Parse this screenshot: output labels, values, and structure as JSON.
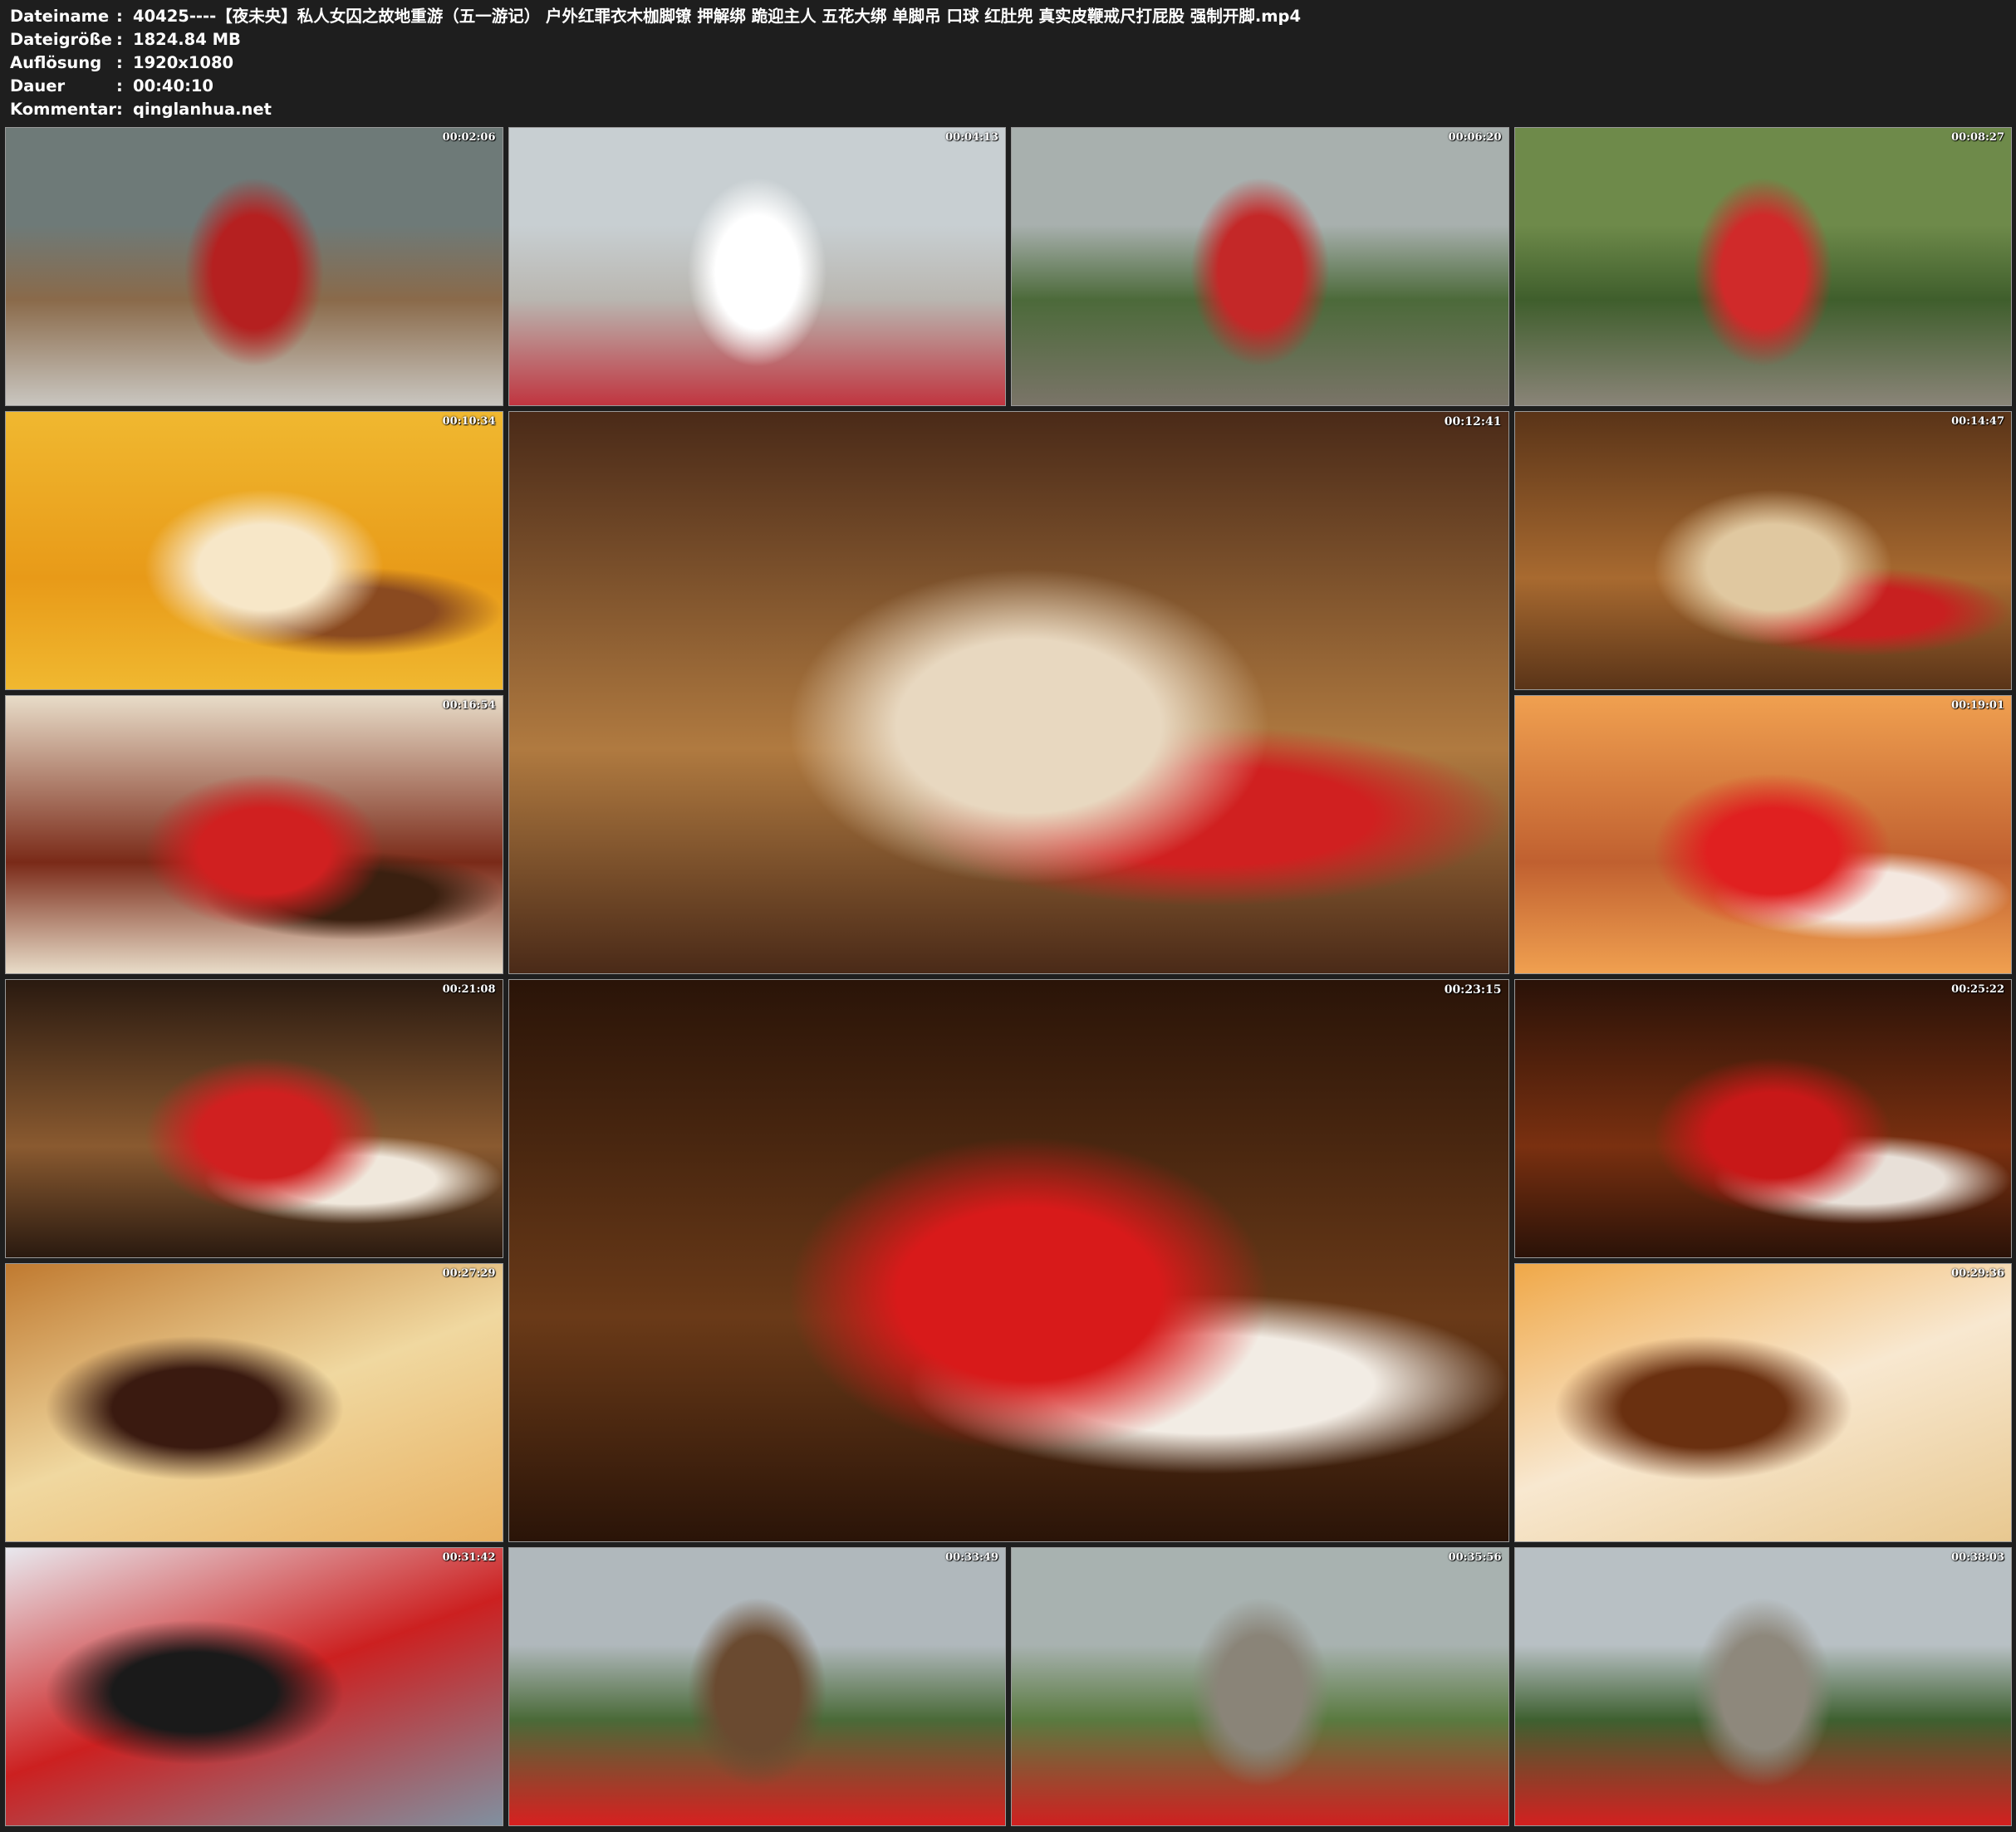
{
  "header": [
    {
      "label": "Dateiname",
      "value": "40425----【夜未央】私人女囚之故地重游（五一游记） 户外红罪衣木枷脚镣 押解绑 跪迎主人 五花大绑 单脚吊 口球 红肚兜 真实皮鞭戒尺打屁股 强制开脚.mp4"
    },
    {
      "label": "Dateigröße",
      "value": "1824.84 MB"
    },
    {
      "label": "Auflösung",
      "value": "1920x1080"
    },
    {
      "label": "Dauer",
      "value": "00:40:10"
    },
    {
      "label": "Kommentar",
      "value": "qinglanhua.net"
    }
  ],
  "separator": ":",
  "thumbnails": [
    {
      "time": "00:02:06",
      "scene": "outdoor-rocks",
      "colors": [
        "#6e7a78",
        "#8a6a4a",
        "#c9c6c0",
        "#b52020"
      ]
    },
    {
      "time": "00:04:13",
      "scene": "pavilion",
      "colors": [
        "#c8cfd2",
        "#b9b6b0",
        "#c03540",
        "#ffffff"
      ]
    },
    {
      "time": "00:06:20",
      "scene": "mountain-path",
      "colors": [
        "#a8b0ae",
        "#4c6a3a",
        "#7a7468",
        "#c42828"
      ]
    },
    {
      "time": "00:08:27",
      "scene": "mountain-path",
      "colors": [
        "#6e8a4a",
        "#3f5e2c",
        "#8a8478",
        "#d02a2a"
      ]
    },
    {
      "time": "00:10:34",
      "scene": "hotel-hallway",
      "colors": [
        "#f0b830",
        "#e89a18",
        "#f7e7c8",
        "#8a4a20"
      ]
    },
    {
      "time": "00:12:41",
      "scene": "sofa-room",
      "big": true,
      "colors": [
        "#4a2a18",
        "#b07a40",
        "#e8d8c0",
        "#d02020"
      ]
    },
    {
      "time": "00:14:47",
      "scene": "sofa-room",
      "colors": [
        "#5a3418",
        "#a86a30",
        "#e0c8a0",
        "#c82020"
      ]
    },
    {
      "time": "00:16:54",
      "scene": "sofa-closeup",
      "colors": [
        "#e8dcc8",
        "#7a2a18",
        "#d02020",
        "#3a2010"
      ]
    },
    {
      "time": "00:19:01",
      "scene": "floor-closeup",
      "colors": [
        "#f0a050",
        "#c06030",
        "#e02020",
        "#f4e8e0"
      ]
    },
    {
      "time": "00:21:08",
      "scene": "room-suspended",
      "colors": [
        "#2a1a10",
        "#8a5a30",
        "#d02020",
        "#f0e8dc"
      ]
    },
    {
      "time": "00:23:15",
      "scene": "room-suspended",
      "big": true,
      "colors": [
        "#2a1408",
        "#6a3a18",
        "#d81a1a",
        "#f2ece4"
      ]
    },
    {
      "time": "00:25:22",
      "scene": "room-dark",
      "colors": [
        "#2a1208",
        "#7a3010",
        "#c81818",
        "#e8e0d8"
      ]
    },
    {
      "time": "00:27:29",
      "scene": "bed",
      "colors": [
        "#c07a30",
        "#f0d8a0",
        "#3a1a10",
        "#e8b060"
      ]
    },
    {
      "time": "00:29:36",
      "scene": "bed",
      "colors": [
        "#f0a848",
        "#f8e8d0",
        "#6a3010",
        "#e8c890"
      ]
    },
    {
      "time": "00:31:42",
      "scene": "bed-blurred",
      "colors": [
        "#e8e8ee",
        "#cc2020",
        "#1a1a1a",
        "#8090a0"
      ]
    },
    {
      "time": "00:33:49",
      "scene": "outdoor-cangue",
      "colors": [
        "#b0b8bc",
        "#4a6a38",
        "#d82020",
        "#6a4a30"
      ]
    },
    {
      "time": "00:35:56",
      "scene": "outdoor-cangue",
      "colors": [
        "#a8b2b0",
        "#5a7a40",
        "#d02020",
        "#8a8478"
      ]
    },
    {
      "time": "00:38:03",
      "scene": "outdoor-cangue",
      "colors": [
        "#b8c0c4",
        "#3e6030",
        "#d42020",
        "#8e887c"
      ]
    }
  ]
}
